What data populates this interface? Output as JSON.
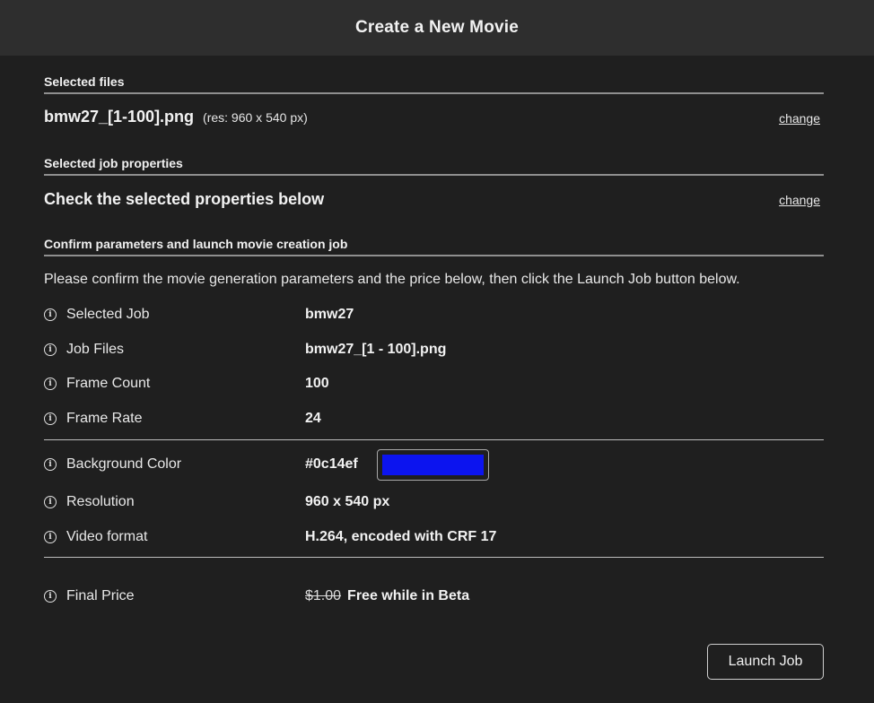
{
  "header": {
    "title": "Create a New Movie"
  },
  "files_section": {
    "label": "Selected files",
    "file_name": "bmw27_[1-100].png",
    "resolution_note": "(res: 960 x 540 px)",
    "change_label": "change"
  },
  "job_section": {
    "label": "Selected job properties",
    "text": "Check the selected properties below",
    "change_label": "change"
  },
  "confirm_section": {
    "label": "Confirm parameters and launch movie creation job",
    "instructions": "Please confirm the movie generation parameters and the price below, then click the Launch Job button below."
  },
  "params": {
    "selected_job": {
      "label": "Selected Job",
      "value": "bmw27"
    },
    "job_files": {
      "label": "Job Files",
      "value": "bmw27_[1 - 100].png"
    },
    "frame_count": {
      "label": "Frame Count",
      "value": "100"
    },
    "frame_rate": {
      "label": "Frame Rate",
      "value": "24"
    },
    "background_color": {
      "label": "Background Color",
      "value": "#0c14ef"
    },
    "resolution": {
      "label": "Resolution",
      "value": "960 x 540 px"
    },
    "video_format": {
      "label": "Video format",
      "value": "H.264, encoded with CRF 17"
    },
    "final_price": {
      "label": "Final Price",
      "old_price": "$1.00",
      "value": "Free while in Beta"
    }
  },
  "info_icon_glyph": "i",
  "launch_button": {
    "label": "Launch Job"
  },
  "colors": {
    "background": "#1f1f1f",
    "header_background": "#2e2e2e",
    "swatch": "#0c14ef"
  }
}
